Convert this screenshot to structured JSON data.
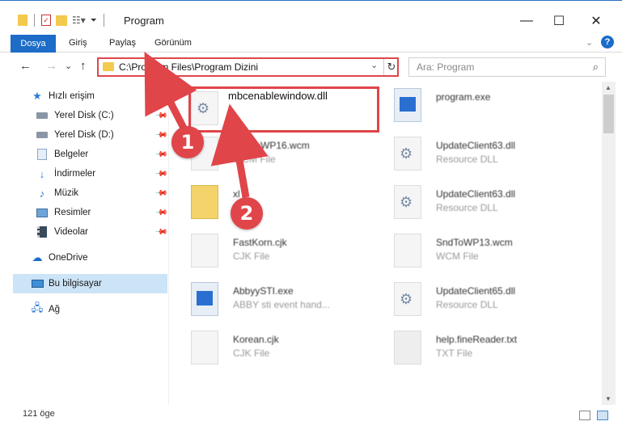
{
  "window": {
    "title": "Program",
    "minimize": "—",
    "maximize": "☐",
    "close": "✕"
  },
  "ribbon": {
    "tabs": [
      {
        "label": "Dosya"
      },
      {
        "label": "Giriş"
      },
      {
        "label": "Paylaş"
      },
      {
        "label": "Görünüm"
      }
    ],
    "expand": "⌄",
    "help": "?"
  },
  "navigation": {
    "back": "←",
    "forward": "→",
    "recent": "⌄",
    "up": "↑",
    "address": "C:\\Program Files\\Program Dizini",
    "address_dropdown": "⌄",
    "refresh": "↻",
    "search_placeholder": "Ara: Program",
    "search_icon": "⌕"
  },
  "sidebar": {
    "items": [
      {
        "label": "Hızlı erişim",
        "icon": "star-icon",
        "pinned": false
      },
      {
        "label": "Yerel Disk (C:)",
        "icon": "drive-icon",
        "pinned": true
      },
      {
        "label": "Yerel Disk (D:)",
        "icon": "drive-icon",
        "pinned": true
      },
      {
        "label": "Belgeler",
        "icon": "documents-icon",
        "pinned": true
      },
      {
        "label": "İndirmeler",
        "icon": "download-icon",
        "pinned": true
      },
      {
        "label": "Müzik",
        "icon": "music-icon",
        "pinned": true
      },
      {
        "label": "Resimler",
        "icon": "pictures-icon",
        "pinned": true
      },
      {
        "label": "Videolar",
        "icon": "video-icon",
        "pinned": true
      },
      {
        "label": "OneDrive",
        "icon": "cloud-icon",
        "pinned": false
      },
      {
        "label": "Bu bilgisayar",
        "icon": "computer-icon",
        "pinned": false,
        "selected": true
      },
      {
        "label": "Ağ",
        "icon": "network-icon",
        "pinned": false
      }
    ]
  },
  "files": [
    {
      "name": "mbcenablewindow.dll",
      "type": "",
      "icon": "dll-gear-icon"
    },
    {
      "name": "program.exe",
      "type": "",
      "icon": "exe-icon"
    },
    {
      "name": "SndToWP16.wcm",
      "type": "WCM File",
      "icon": "file-icon"
    },
    {
      "name": "UpdateClient63.dll",
      "type": "Resource DLL",
      "icon": "dll-gear-icon"
    },
    {
      "name": "xl",
      "type": "",
      "icon": "folder-file-icon"
    },
    {
      "name": "UpdateClient63.dll",
      "type": "Resource DLL",
      "icon": "dll-gear-icon"
    },
    {
      "name": "FastKorn.cjk",
      "type": "CJK File",
      "icon": "file-icon"
    },
    {
      "name": "SndToWP13.wcm",
      "type": "WCM File",
      "icon": "file-icon"
    },
    {
      "name": "AbbyySTI.exe",
      "type": "ABBY sti event hand...",
      "icon": "exe-icon"
    },
    {
      "name": "UpdateClient65.dll",
      "type": "Resource DLL",
      "icon": "dll-gear-icon"
    },
    {
      "name": "Korean.cjk",
      "type": "CJK File",
      "icon": "file-icon"
    },
    {
      "name": "help.fineReader.txt",
      "type": "TXT File",
      "icon": "text-file-icon"
    }
  ],
  "annotations": {
    "step1": "1",
    "step2": "2",
    "color": "#e0454a"
  },
  "status": {
    "count": "121 öge"
  },
  "colors": {
    "accent": "#1c6cc8",
    "highlight": "#e0454a",
    "selection": "#cce4f7"
  }
}
